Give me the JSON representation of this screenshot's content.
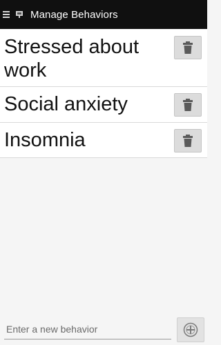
{
  "appbar": {
    "title": "Manage Behaviors",
    "nav_icon": "hamburger-menu-icon",
    "app_icon": "app-logo-icon"
  },
  "behaviors": [
    {
      "label": "Stressed about work",
      "delete_icon": "trash-icon"
    },
    {
      "label": "Social anxiety",
      "delete_icon": "trash-icon"
    },
    {
      "label": "Insomnia",
      "delete_icon": "trash-icon"
    }
  ],
  "new_behavior": {
    "placeholder": "Enter a new behavior",
    "value": "",
    "add_icon": "add-circle-icon"
  },
  "colors": {
    "appbar_bg": "#101010",
    "page_bg": "#f5f5f5",
    "button_bg": "#dcdcdc",
    "icon_gray": "#5a5a5a"
  }
}
